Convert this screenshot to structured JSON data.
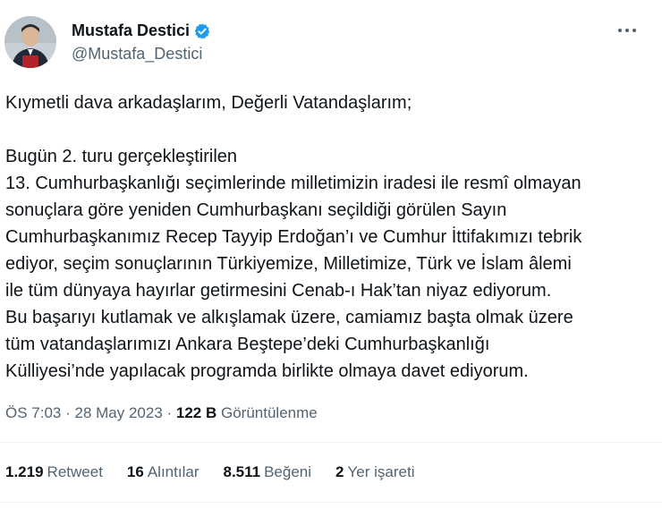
{
  "author": {
    "name": "Mustafa Destici",
    "handle": "@Mustafa_Destici"
  },
  "icons": {
    "verified": "verified-badge-icon",
    "more": "more-options-icon"
  },
  "colors": {
    "verified": "#1d9bf0",
    "text": "#0f1419",
    "secondary": "#536471"
  },
  "tweet": {
    "greeting": "Kıymetli dava arkadaşlarım, Değerli Vatandaşlarım;",
    "lines": [
      "Bugün 2. turu gerçekleştirilen",
      "13. Cumhurbaşkanlığı seçimlerinde milletimizin iradesi ile resmî olmayan",
      "sonuçlara göre yeniden Cumhurbaşkanı seçildiği görülen Sayın",
      "Cumhurbaşkanımız Recep Tayyip Erdoğan’ı ve Cumhur İttifakımızı tebrik",
      "ediyor, seçim sonuçlarının Türkiyemize, Milletimize, Türk ve İslam âlemi",
      "ile tüm dünyaya hayırlar getirmesini Cenab-ı Hak’tan niyaz ediyorum.",
      "Bu başarıyı kutlamak ve alkışlamak üzere,  camiamız başta olmak üzere",
      "tüm vatandaşlarımızı Ankara Beştepe’deki Cumhurbaşkanlığı",
      "Külliyesi’nde yapılacak programda birlikte olmaya davet ediyorum."
    ]
  },
  "meta": {
    "time": "ÖS 7:03",
    "sep1": " · ",
    "date": "28 May 2023",
    "sep2": " · ",
    "views_count": "122 B",
    "views_label": "Görüntülenme"
  },
  "stats": [
    {
      "count": "1.219",
      "label": "Retweet"
    },
    {
      "count": "16",
      "label": "Alıntılar"
    },
    {
      "count": "8.511",
      "label": "Beğeni"
    },
    {
      "count": "2",
      "label": "Yer işareti"
    }
  ]
}
